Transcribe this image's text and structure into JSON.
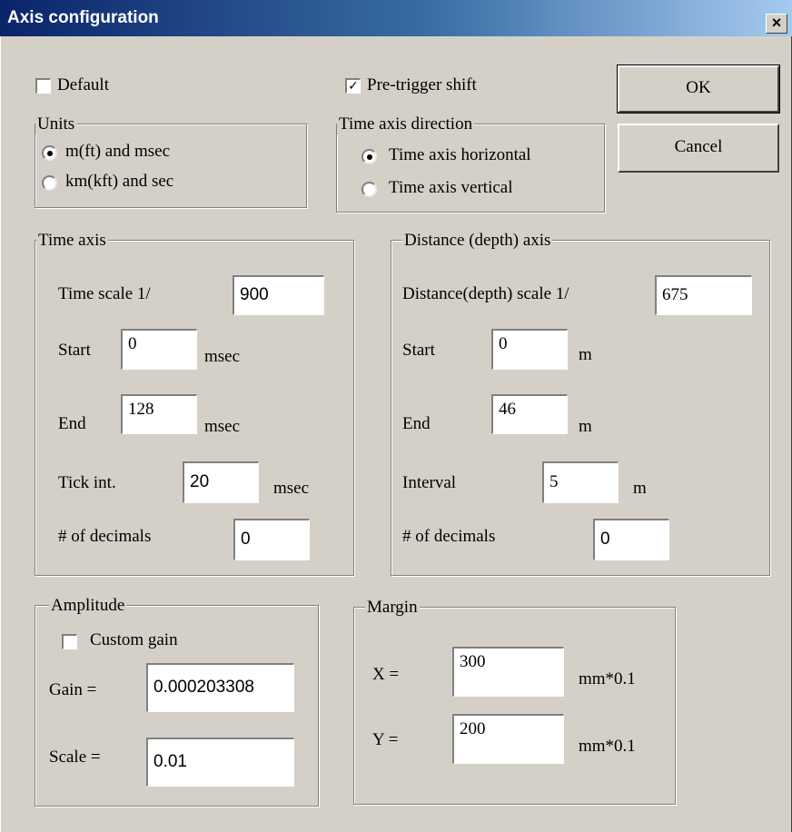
{
  "window": {
    "title": "Axis configuration",
    "close_glyph": "×"
  },
  "top": {
    "default_label": "Default",
    "default_checked": false,
    "pretrigger_label": "Pre-trigger shift",
    "pretrigger_checked": true,
    "ok_label": "OK",
    "cancel_label": "Cancel"
  },
  "units": {
    "title": "Units",
    "options": [
      "m(ft) and msec",
      "km(kft) and sec"
    ],
    "selected": 0
  },
  "time_direction": {
    "title": "Time axis direction",
    "options": [
      "Time axis horizontal",
      "Time axis vertical"
    ],
    "selected": 0
  },
  "time_axis": {
    "title": "Time axis",
    "scale_label": "Time scale  1/",
    "scale_value": "900",
    "start_label": "Start",
    "start_value": "0",
    "start_unit": "msec",
    "end_label": "End",
    "end_value": "128",
    "end_unit": "msec",
    "tick_label": "Tick int.",
    "tick_value": "20",
    "tick_unit": "msec",
    "decimals_label": "# of decimals",
    "decimals_value": "0"
  },
  "distance_axis": {
    "title": "Distance (depth) axis",
    "scale_label": "Distance(depth) scale  1/",
    "scale_value": "675",
    "start_label": "Start",
    "start_value": "0",
    "start_unit": "m",
    "end_label": "End",
    "end_value": "46",
    "end_unit": "m",
    "interval_label": "Interval",
    "interval_value": "5",
    "interval_unit": "m",
    "decimals_label": "# of decimals",
    "decimals_value": "0"
  },
  "amplitude": {
    "title": "Amplitude",
    "custom_gain_label": "Custom gain",
    "custom_gain_checked": false,
    "gain_label": "Gain =",
    "gain_value": "0.000203308",
    "scale_label": "Scale =",
    "scale_value": "0.01"
  },
  "margin": {
    "title": "Margin",
    "x_label": "X =",
    "x_value": "300",
    "x_unit": "mm*0.1",
    "y_label": "Y =",
    "y_value": "200",
    "y_unit": "mm*0.1"
  }
}
